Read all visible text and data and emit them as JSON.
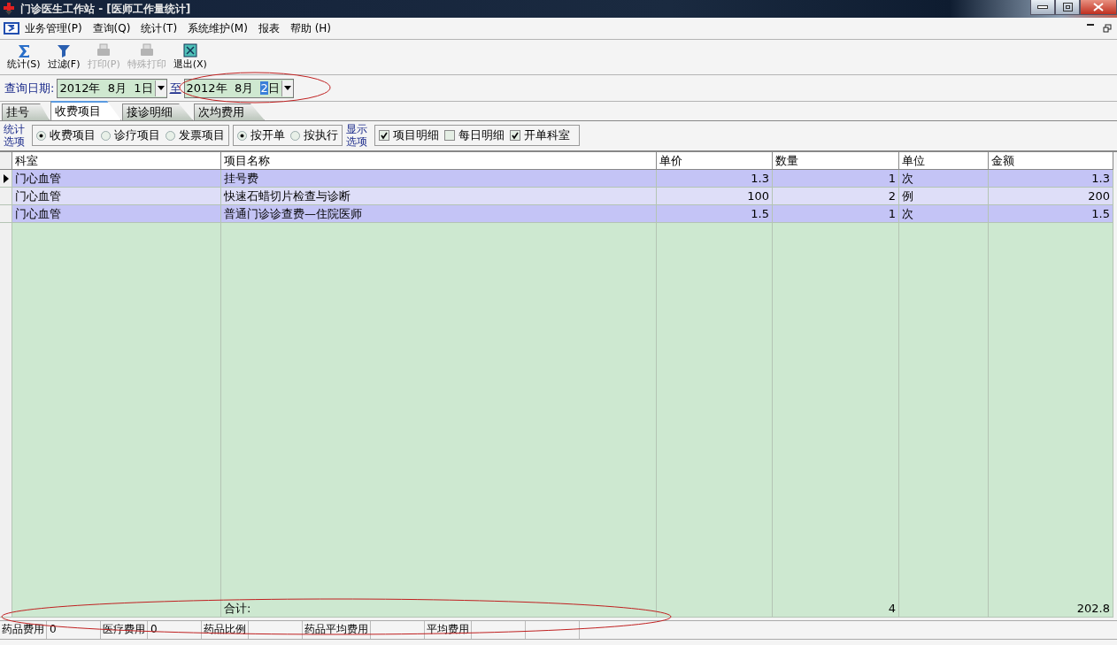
{
  "window": {
    "title": "门诊医生工作站 - [医师工作量统计]"
  },
  "menu": {
    "items": [
      "业务管理(P)",
      "查询(Q)",
      "统计(T)",
      "系统维护(M)",
      "报表",
      "帮助 (H)"
    ]
  },
  "toolbar": [
    {
      "kind": "sum",
      "label": "统计(S)",
      "disabled": false
    },
    {
      "kind": "filter",
      "label": "过滤(F)",
      "disabled": false
    },
    {
      "kind": "print",
      "label": "打印(P)",
      "disabled": true
    },
    {
      "kind": "print",
      "label": "特殊打印",
      "disabled": true
    },
    {
      "kind": "exit",
      "label": "退出(X)",
      "disabled": false
    }
  ],
  "date_range": {
    "label": "查询日期:",
    "from": "2012年  8月  1日",
    "separator": "至",
    "to": "2012年  8月  ",
    "to_highlighted": "2",
    "to_suffix": "日"
  },
  "tabs": [
    {
      "label": "挂号",
      "selected": false
    },
    {
      "label": "收费项目",
      "selected": true
    },
    {
      "label": "接诊明细",
      "selected": false
    },
    {
      "label": "次均费用",
      "selected": false
    }
  ],
  "stat_options": {
    "label": "统计选项",
    "radios": [
      {
        "label": "收费项目",
        "selected": true
      },
      {
        "label": "诊疗项目",
        "selected": false
      },
      {
        "label": "发票项目",
        "selected": false
      }
    ]
  },
  "basis_options": {
    "radios": [
      {
        "label": "按开单",
        "selected": true
      },
      {
        "label": "按执行",
        "selected": false
      }
    ]
  },
  "display_options": {
    "label": "显示选项",
    "checks": [
      {
        "label": "项目明细",
        "checked": true
      },
      {
        "label": "每日明细",
        "checked": false
      },
      {
        "label": "开单科室",
        "checked": true
      }
    ]
  },
  "table": {
    "columns": [
      {
        "label": "科室"
      },
      {
        "label": "项目名称"
      },
      {
        "label": "单价"
      },
      {
        "label": "数量"
      },
      {
        "label": "单位"
      },
      {
        "label": "金额"
      }
    ],
    "rows": [
      {
        "selected": true,
        "cells": [
          "门心血管",
          "挂号费",
          "1.3",
          "1",
          "次",
          "1.3"
        ]
      },
      {
        "selected": false,
        "cells": [
          "门心血管",
          "快速石蜡切片检查与诊断",
          "100",
          "2",
          "例",
          "200"
        ]
      },
      {
        "selected": false,
        "cells": [
          "门心血管",
          "普通门诊诊查费—住院医师",
          "1.5",
          "1",
          "次",
          "1.5"
        ]
      }
    ],
    "total": {
      "label": "合计:",
      "quantity": "4",
      "amount": "202.8"
    }
  },
  "status_bar": [
    {
      "label": "药品费用",
      "value": "0"
    },
    {
      "label": "医疗费用",
      "value": "0"
    },
    {
      "label": "药品比例"
    },
    {
      "label": "药品平均费用"
    },
    {
      "label": "平均费用"
    }
  ]
}
